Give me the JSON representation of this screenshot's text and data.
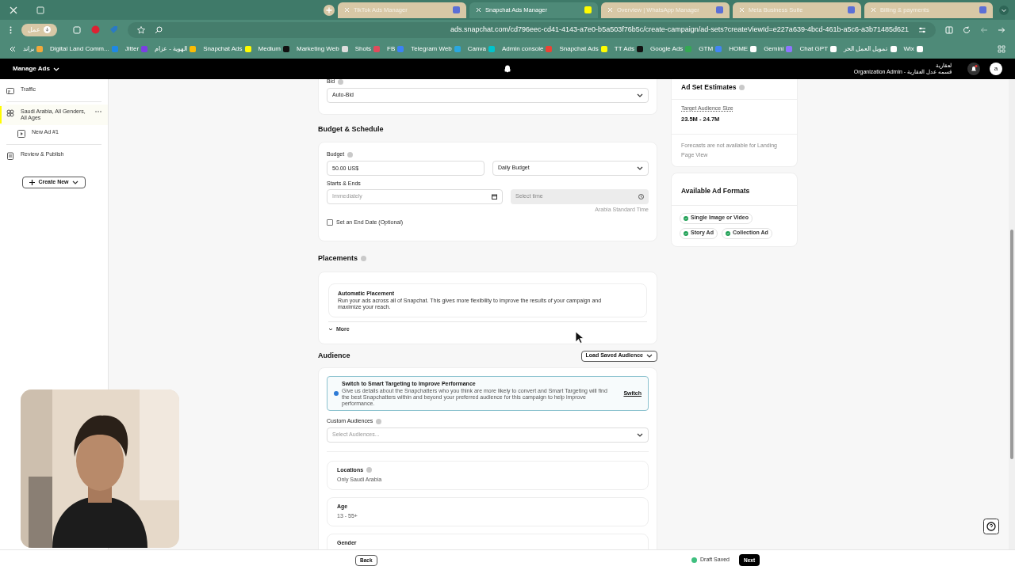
{
  "browser": {
    "tabs": [
      {
        "label": "TikTok Ads Manager",
        "selected": false
      },
      {
        "label": "Snapchat Ads Manager",
        "selected": true
      },
      {
        "label": "Overview | WhatsApp Manager",
        "selected": false
      },
      {
        "label": "Meta Business Suite",
        "selected": false
      },
      {
        "label": "Billing & payments",
        "selected": false
      }
    ],
    "profile": "عمل",
    "address": "ads.snapchat.com/cd796eec-cd41-4143-a7e0-b5a503f76b5c/create-campaign/ad-sets?createViewId=e227a639-4bcd-461b-a5c6-a3b71485d621",
    "bookmarks": [
      "براند",
      "Digital Land Comm...",
      "Jitter",
      "الهوية - عزام",
      "Snapchat Ads",
      "Medium",
      "Marketing Web",
      "Shots",
      "FB",
      "Telegram Web",
      "Canva",
      "Admin console",
      "Snapchat Ads",
      "TT Ads",
      "Google Ads",
      "GTM",
      "HOME",
      "Gemini",
      "Chat GPT",
      "تمويل العمل الحر",
      "Wix"
    ]
  },
  "header": {
    "menu": "Manage Ads",
    "org_name": "لعقارية",
    "org_role": "Organization Admin - قسمه عدل العقارية",
    "avatar": "a"
  },
  "sidebar": {
    "items": [
      {
        "kind": "campaign",
        "label": "Traffic",
        "selected": false
      },
      {
        "kind": "adset",
        "label": "Saudi Arabia, All Genders, All Ages",
        "selected": true,
        "children": [
          {
            "kind": "ad",
            "label": "New Ad #1",
            "selected": false
          }
        ]
      },
      {
        "kind": "review",
        "label": "Review & Publish",
        "selected": false
      }
    ],
    "create_button": "Create New"
  },
  "form": {
    "bid": {
      "label": "Bid",
      "value": "Auto-Bid"
    },
    "budget_title": "Budget & Schedule",
    "budget": {
      "label": "Budget",
      "value": "50.00 US$",
      "type": "Daily Budget"
    },
    "schedule": {
      "label": "Starts & Ends",
      "start_placeholder": "Immediately",
      "time_placeholder": "Select time",
      "timezone": "Arabia Standard Time"
    },
    "end_date": {
      "label": "Set an End Date (Optional)",
      "checked": false
    },
    "placements": {
      "title": "Placements",
      "option_title": "Automatic Placement",
      "option_text": "Run your ads across all of Snapchat. This gives more flexibility to improve the results of your campaign and maximize your reach.",
      "more": "More"
    },
    "audience": {
      "title": "Audience",
      "load_button": "Load Saved Audience",
      "smart": {
        "title": "Switch to Smart Targeting to Improve Performance",
        "text": "Give us details about the Snapchatters who you think are more likely to convert and Smart Targeting will find the best Snapchatters within and beyond your preferred audience for this campaign to help improve performance.",
        "action": "Switch"
      },
      "custom": {
        "label": "Custom Audiences",
        "placeholder": "Select Audiences..."
      },
      "rows": [
        {
          "label": "Locations",
          "value": "Only Saudi Arabia",
          "info": true
        },
        {
          "label": "Age",
          "value": "13 - 55+",
          "info": false
        },
        {
          "label": "Gender",
          "info": false
        }
      ]
    }
  },
  "estimates": {
    "title": "Ad Set Estimates",
    "size_label": "Target Audience Size",
    "size_value": "23.5M - 24.7M",
    "note": "Forecasts are not available for Landing Page View"
  },
  "formats": {
    "title": "Available Ad Formats",
    "items": [
      "Single Image or Video",
      "Story Ad",
      "Collection Ad"
    ]
  },
  "footer": {
    "back": "Back",
    "draft": "Draft Saved",
    "next": "Next"
  }
}
